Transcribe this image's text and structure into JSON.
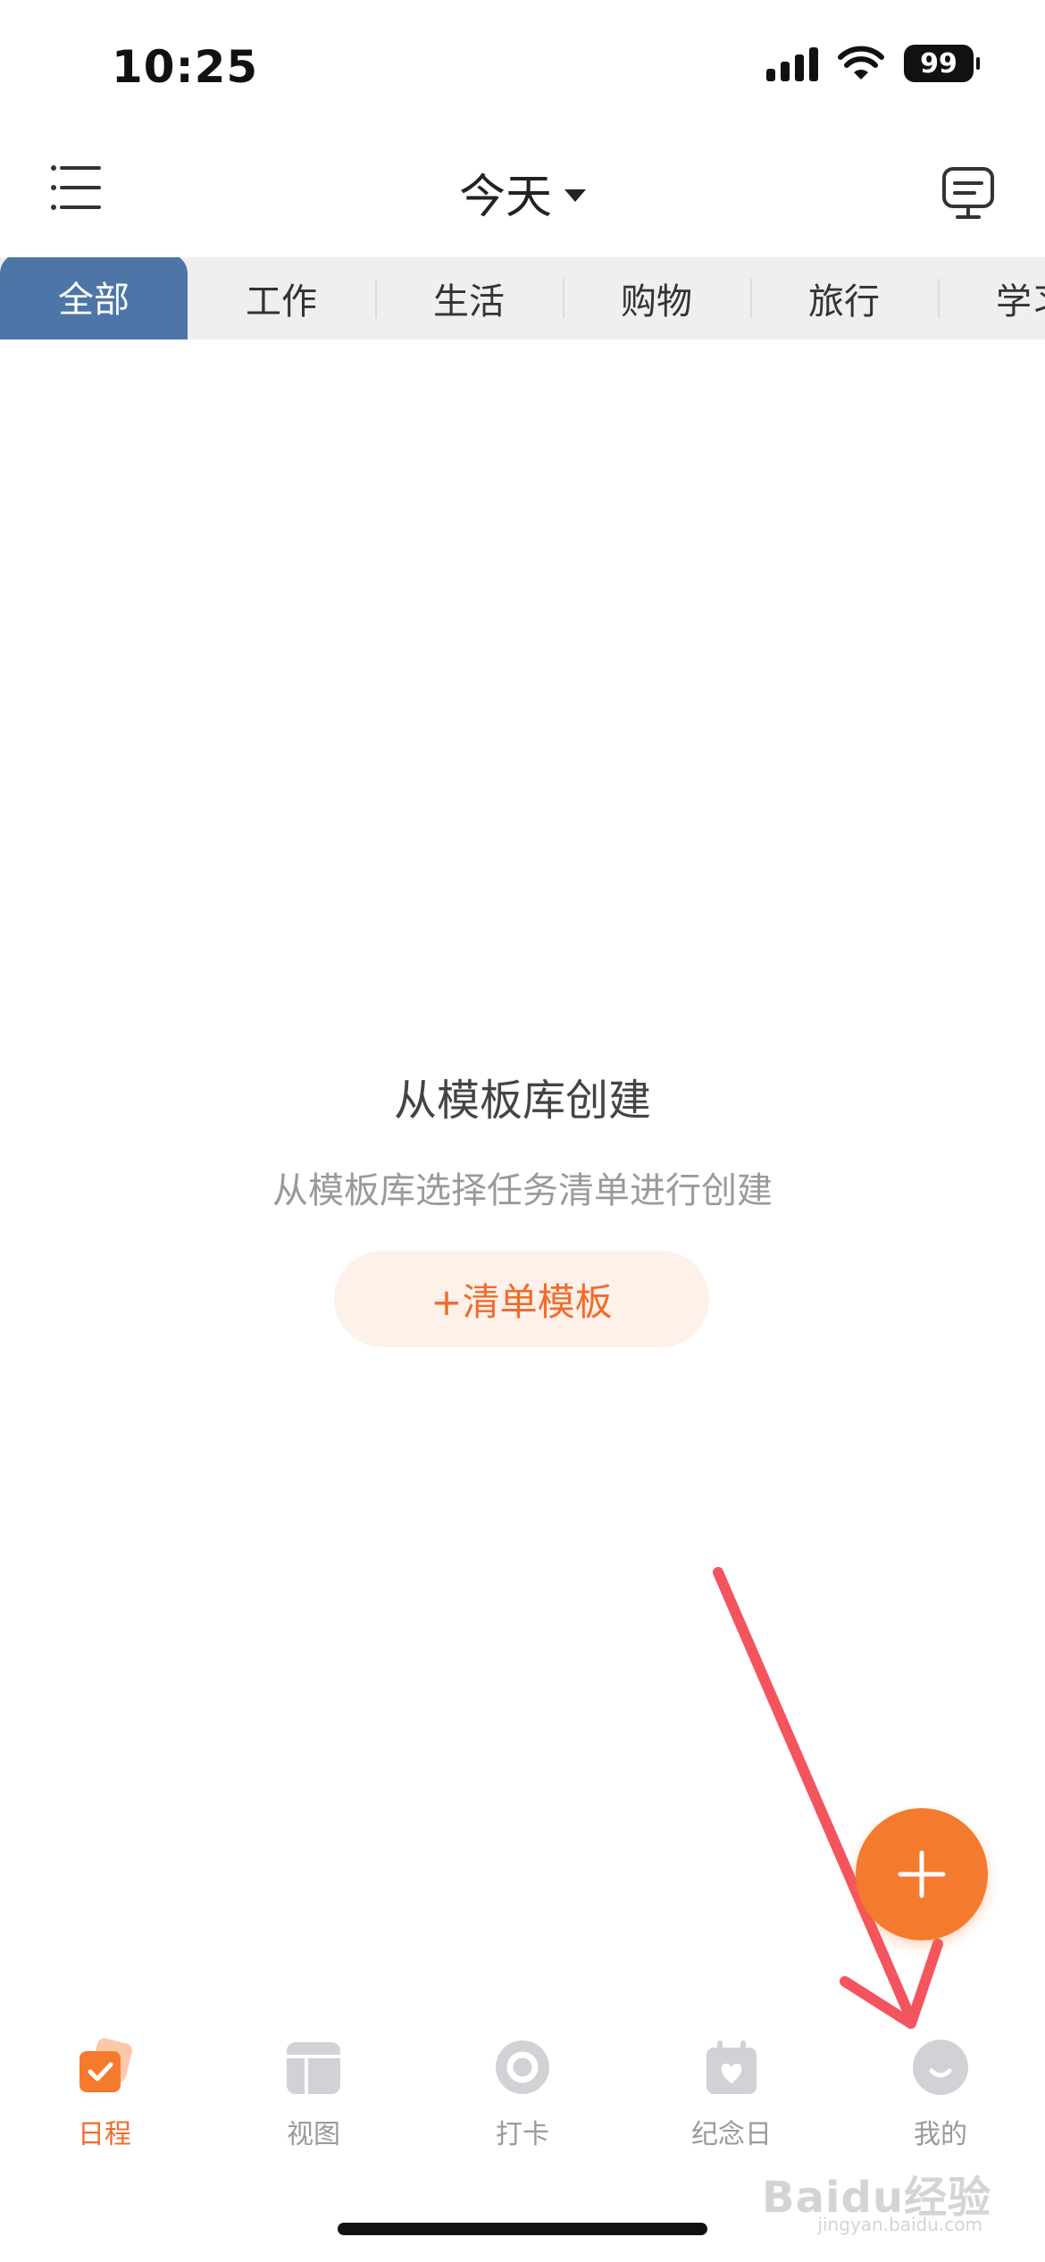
{
  "status_bar": {
    "time": "10:25",
    "battery": "99"
  },
  "header": {
    "title": "今天"
  },
  "tabs": [
    {
      "label": "全部",
      "active": true
    },
    {
      "label": "工作",
      "active": false
    },
    {
      "label": "生活",
      "active": false
    },
    {
      "label": "购物",
      "active": false
    },
    {
      "label": "旅行",
      "active": false
    },
    {
      "label": "学习",
      "active": false
    }
  ],
  "empty_state": {
    "title": "从模板库创建",
    "subtitle": "从模板库选择任务清单进行创建",
    "button_label": "+清单模板"
  },
  "bottom_nav": [
    {
      "label": "日程",
      "icon": "schedule-check-icon",
      "active": true
    },
    {
      "label": "视图",
      "icon": "layout-view-icon",
      "active": false
    },
    {
      "label": "打卡",
      "icon": "checkin-ring-icon",
      "active": false
    },
    {
      "label": "纪念日",
      "icon": "anniversary-calendar-icon",
      "active": false
    },
    {
      "label": "我的",
      "icon": "profile-smile-icon",
      "active": false
    }
  ],
  "watermark": {
    "text": "Baidu经验",
    "sub": "jingyan.baidu.com"
  },
  "colors": {
    "accent": "#f47a2e",
    "tab_active": "#4e75a8",
    "annotation_arrow": "#f4545e"
  }
}
